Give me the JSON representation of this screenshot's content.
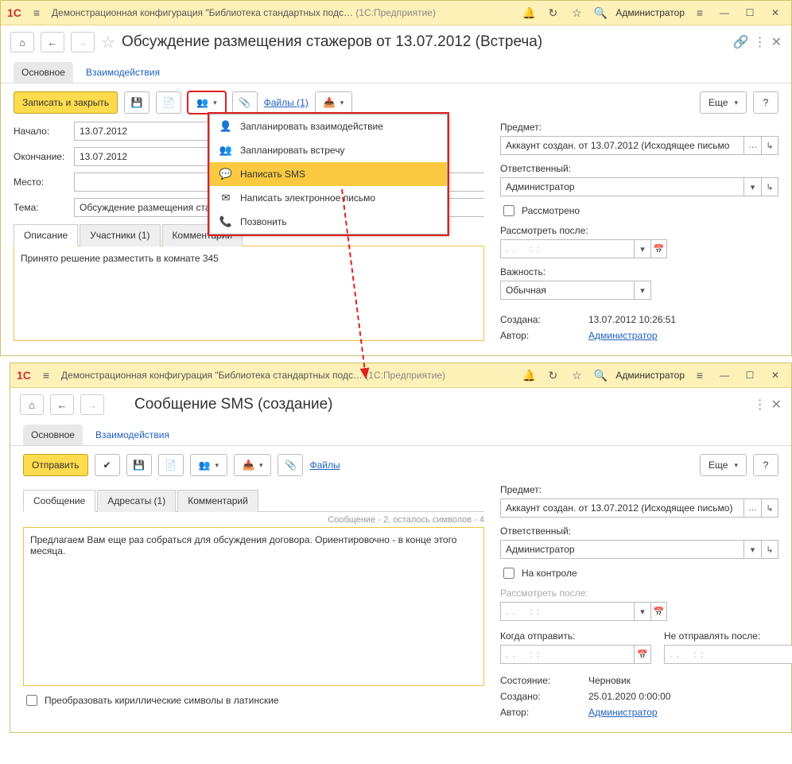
{
  "app": {
    "title": "Демонстрационная конфигурация \"Библиотека стандартных подс…",
    "suffix": "(1С:Предприятие)",
    "user": "Администратор"
  },
  "window1": {
    "title": "Обсуждение размещения стажеров от 13.07.2012 (Встреча)",
    "section_tabs": {
      "main": "Основное",
      "inter": "Взаимодействия"
    },
    "toolbar": {
      "write_close": "Записать и закрыть",
      "files": "Файлы (1)",
      "more": "Еще"
    },
    "labels": {
      "start": "Начало:",
      "end": "Окончание:",
      "place": "Место:",
      "topic": "Тема:",
      "subject": "Предмет:",
      "responsible": "Ответственный:",
      "reviewed": "Рассмотрено",
      "review_after": "Рассмотреть после:",
      "importance": "Важность:",
      "created": "Создана:",
      "author": "Автор:"
    },
    "values": {
      "start": "13.07.2012",
      "end": "13.07.2012",
      "place": "",
      "topic": "Обсуждение размещения ста",
      "subject": "Аккаунт создан. от 13.07.2012 (Исходящее письмо",
      "responsible": "Администратор",
      "review_after": ". .    : :",
      "importance": "Обычная",
      "created": "13.07.2012 10:26:51",
      "author": "Администратор"
    },
    "sub_tabs": {
      "desc": "Описание",
      "participants": "Участники (1)",
      "comment": "Комментарий"
    },
    "description_text": "Принято решение разместить в комнате 345"
  },
  "menu": {
    "plan_inter": "Запланировать взаимодействие",
    "plan_meeting": "Запланировать встречу",
    "write_sms": "Написать SMS",
    "write_email": "Написать электронное письмо",
    "call": "Позвонить"
  },
  "window2": {
    "title": "Сообщение SMS (создание)",
    "section_tabs": {
      "main": "Основное",
      "inter": "Взаимодействия"
    },
    "toolbar": {
      "send": "Отправить",
      "files": "Файлы",
      "more": "Еще"
    },
    "sub_tabs": {
      "msg": "Сообщение",
      "recipients": "Адресаты (1)",
      "comment": "Комментарий"
    },
    "msg_info": "Сообщение - 2, осталось символов - 4",
    "msg_text": "Предлагаем Вам еще раз собраться для обсуждения договора. Ориентировочно - в конце этого месяца.",
    "transliterate": "Преобразовать кириллические символы в латинские",
    "labels": {
      "subject": "Предмет:",
      "responsible": "Ответственный:",
      "on_control": "На контроле",
      "review_after": "Рассмотреть после:",
      "when_send": "Когда отправить:",
      "no_send_after": "Не отправлять после:",
      "state": "Состояние:",
      "created": "Создано:",
      "author": "Автор:"
    },
    "values": {
      "subject": "Аккаунт создан. от 13.07.2012 (Исходящее письмо)",
      "responsible": "Администратор",
      "review_after": ". .    : :",
      "when_send": ". .    : :",
      "no_send_after": ". .    : :",
      "state": "Черновик",
      "created": "25.01.2020 0:00:00",
      "author": "Администратор"
    }
  }
}
